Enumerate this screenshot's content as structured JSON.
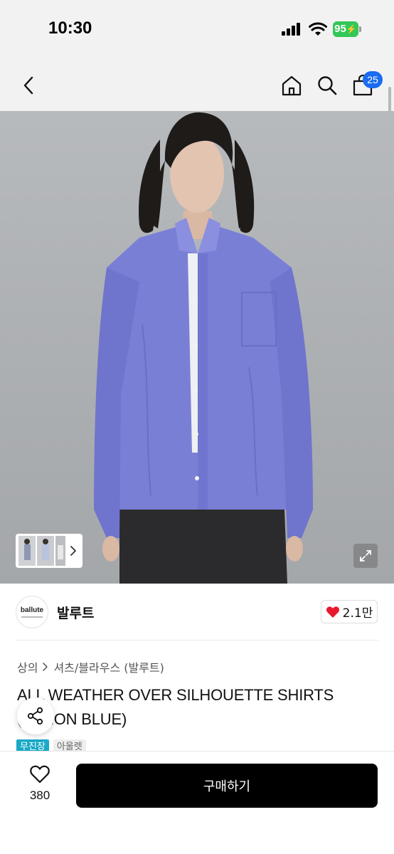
{
  "status_bar": {
    "time": "10:30",
    "battery": "95"
  },
  "nav": {
    "back_icon": "chevron-left-icon",
    "home_icon": "home-icon",
    "search_icon": "search-icon",
    "cart_icon": "bag-icon",
    "cart_count": "25"
  },
  "gallery": {
    "expand_icon": "expand-icon",
    "thumbnail_next_icon": "chevron-right-icon"
  },
  "brand": {
    "logo_text": "ballute",
    "name": "발루트",
    "like_count": "2.1만",
    "like_icon": "heart-filled-icon"
  },
  "breadcrumb": {
    "items": [
      "상의",
      "셔츠/블라우스 (발루트)"
    ]
  },
  "product": {
    "title": "ALL WEATHER OVER SILHOUETTE SHIRTS (LEMON BLUE)",
    "tags": [
      "무진장",
      "아울렛"
    ]
  },
  "share": {
    "icon": "share-icon"
  },
  "bottom_bar": {
    "wish_icon": "heart-outline-icon",
    "wish_count": "380",
    "buy_label": "구매하기"
  },
  "colors": {
    "accent_blue": "#1a6cf0",
    "battery_green": "#34c759",
    "tag_teal": "#1aa9c7",
    "heart_red": "#e8192c",
    "shirt_blue": "#7a7fd6"
  }
}
